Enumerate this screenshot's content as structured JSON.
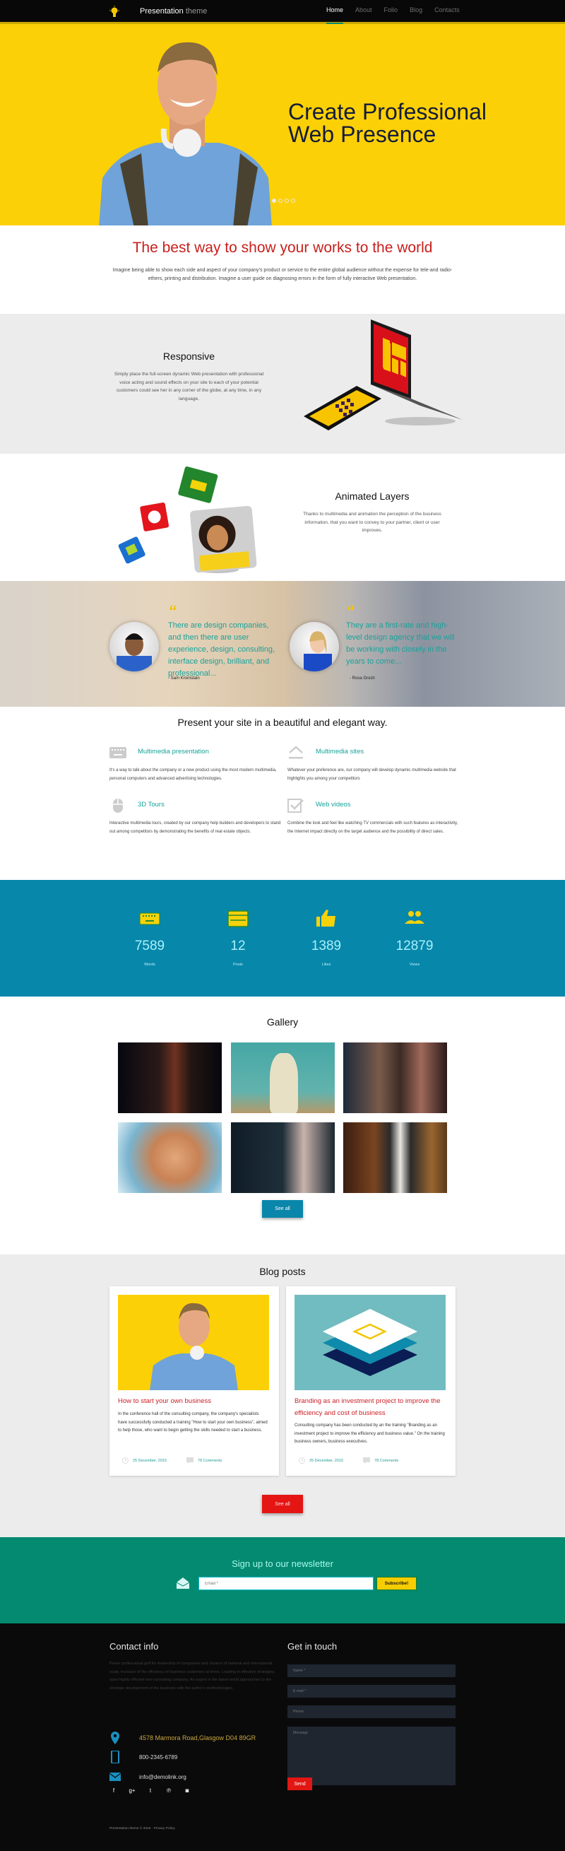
{
  "header": {
    "brand_main": "Presentation",
    "brand_sub": "theme",
    "nav": [
      {
        "label": "Home",
        "active": true
      },
      {
        "label": "About",
        "active": false
      },
      {
        "label": "Folio",
        "active": false
      },
      {
        "label": "Blog",
        "active": false
      },
      {
        "label": "Contacts",
        "active": false
      }
    ]
  },
  "hero": {
    "title_line1": "Create Professional",
    "title_line2": "Web Presence",
    "slides": 4,
    "active_slide": 1
  },
  "intro": {
    "title": "The best way to show your works to the world",
    "text": "Imagine being able to show each side and aspect of your company's product or service to the entire global audience without the expense for tele-and radio-ethers, printing and distribution. Imagine a user guide on diagnosing errors in the form of fully interactive Web presentation."
  },
  "features": [
    {
      "title": "Responsive",
      "text": "Simply place the full-screen dynamic Web presentation with professional voice acting and sound effects on your site to each of your potential customers could see her in any corner of the globe, at any time, in any language."
    },
    {
      "title": "Animated Layers",
      "text": "Thanks to multimedia and animation the perception of the business information, that you want to convey to your partner, client or user improves."
    }
  ],
  "testimonials": [
    {
      "quote": "There are design companies, and then there are user experience, design, consulting, interface design, brilliant, and professional...",
      "author": "- Sam Kromstain"
    },
    {
      "quote": "They are a first-rate and high-level design agency that we will be working with closely in the years to come...",
      "author": "- Rosa Grosh"
    }
  ],
  "services": {
    "title": "Present your site in a beautiful and elegant way.",
    "items": [
      {
        "icon": "keyboard-icon",
        "title": "Multimedia presentation",
        "text": "It's a way to talk about the company or a new product using the most modern multimedia, personal computers and advanced advertising technologies."
      },
      {
        "icon": "eject-icon",
        "title": "Multimedia sites",
        "text": "Whatever your preference are, our company will develop dynamic multimedia website that highlights you among your competitors"
      },
      {
        "icon": "mouse-icon",
        "title": "3D Tours",
        "text": "Interactive multimedia tours, created by our company help builders and developers to stand out among competitors by demonstrating the benefits of real estate objects."
      },
      {
        "icon": "checkbox-icon",
        "title": "Web videos",
        "text": "Combine the look and feel like watching TV commercials with such features as interactivity, the Internet impact directly on the target audience and the possibility of direct sales."
      }
    ]
  },
  "stats": [
    {
      "icon": "keyboard-icon",
      "value": "7589",
      "label": "Words"
    },
    {
      "icon": "web-icon",
      "value": "12",
      "label": "Posts"
    },
    {
      "icon": "thumb-up-icon",
      "value": "1389",
      "label": "Likes"
    },
    {
      "icon": "people-icon",
      "value": "12879",
      "label": "Views"
    }
  ],
  "gallery": {
    "title": "Gallery",
    "button": "See all"
  },
  "blog": {
    "title": "Blog posts",
    "button": "See all",
    "posts": [
      {
        "title": "How to start your own business",
        "text": "In the conference hall of the consulting company, the company's specialists have successfully conducted a training \"How to start your own business\", aimed to help those, who want to begin getting the skills needed to start a business.",
        "date": "25 December, 2015",
        "comments": "78 Comments"
      },
      {
        "title": "Branding as an investment project to improve the efficiency and cost of business",
        "text": "Consulting company has been conducted by an the training \"Branding as an investment project to improve the efficiency and business value.\" On the training business owners, business executives.",
        "date": "25 December, 2015",
        "comments": "78 Comments"
      }
    ]
  },
  "newsletter": {
    "title": "Sign up to our newsletter",
    "placeholder": "Email *",
    "button": "Subscribe!"
  },
  "footer": {
    "contact_title": "Contact info",
    "about": "Power professional golf for leadership of companies and clusters of national and international scale, increase of the efficiency of business customers at times. Leading in effective strategies, open highly efficient neo-consulting company. An expert in the latest world approaches to the strategic development of the business with the author's methodologies.",
    "address": "4578 Marmora Road,Glasgow D04 89GR",
    "phone": "800-2345-6789",
    "email": "info@demolink.org",
    "social": [
      "facebook-icon",
      "google-plus-icon",
      "twitter-icon",
      "pinterest-icon",
      "instagram-icon"
    ],
    "copyright": "Presentation theme © 2016 · Privacy Policy",
    "form_title": "Get in touch",
    "name_placeholder": "Name *",
    "email_placeholder": "E-mail *",
    "phone_placeholder": "Phone",
    "message_placeholder": "Message",
    "send": "Send"
  },
  "colors": {
    "yellow": "#fcd006",
    "red": "#c8201c",
    "teal": "#17a39a",
    "blue": "#0787aa",
    "green": "#038a70",
    "dark": "#0a0a0a"
  }
}
